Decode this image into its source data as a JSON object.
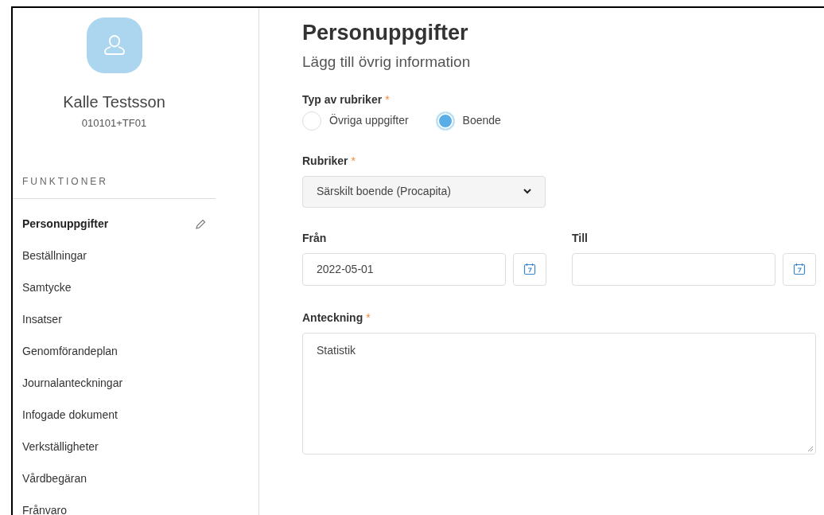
{
  "profile": {
    "name": "Kalle Testsson",
    "id_number": "010101+TF01"
  },
  "sidebar": {
    "heading": "FUNKTIONER",
    "items": [
      {
        "label": "Personuppgifter",
        "selected": true
      },
      {
        "label": "Beställningar",
        "selected": false
      },
      {
        "label": "Samtycke",
        "selected": false
      },
      {
        "label": "Insatser",
        "selected": false
      },
      {
        "label": "Genomförandeplan",
        "selected": false
      },
      {
        "label": "Journalanteckningar",
        "selected": false
      },
      {
        "label": "Infogade dokument",
        "selected": false
      },
      {
        "label": "Verkställigheter",
        "selected": false
      },
      {
        "label": "Vårdbegäran",
        "selected": false
      },
      {
        "label": "Frånvaro",
        "selected": false
      }
    ]
  },
  "page": {
    "title": "Personuppgifter",
    "subtitle": "Lägg till övrig information"
  },
  "type_field": {
    "label": "Typ av rubriker",
    "required_mark": "*",
    "options": [
      {
        "label": "Övriga uppgifter",
        "selected": false
      },
      {
        "label": "Boende",
        "selected": true
      }
    ]
  },
  "heading_field": {
    "label": "Rubriker",
    "required_mark": "*",
    "value": "Särskilt boende (Procapita)"
  },
  "date_fields": [
    {
      "label": "Från",
      "value": "2022-05-01"
    },
    {
      "label": "Till"
    }
  ],
  "note_field": {
    "label": "Anteckning",
    "required_mark": "*",
    "value": "Statistik"
  }
}
